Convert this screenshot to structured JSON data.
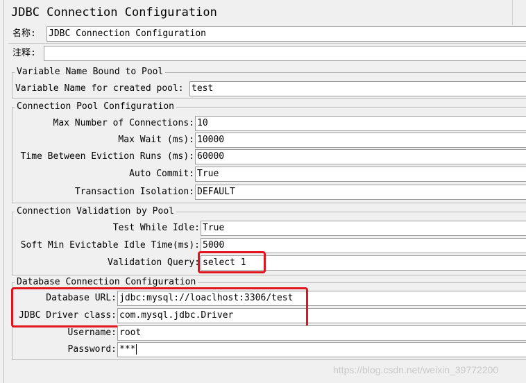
{
  "title": "JDBC Connection Configuration",
  "name_label": "名称:",
  "name_value": "JDBC Connection Configuration",
  "comment_label": "注释:",
  "comment_value": "",
  "variable_section": {
    "legend": "Variable Name Bound to Pool",
    "pool_var_label": "Variable Name for created pool:",
    "pool_var_value": "test"
  },
  "pool_section": {
    "legend": "Connection Pool Configuration",
    "max_conn_label": "Max Number of Connections:",
    "max_conn_value": "10",
    "max_wait_label": "Max Wait (ms):",
    "max_wait_value": "10000",
    "eviction_label": "Time Between Eviction Runs (ms):",
    "eviction_value": "60000",
    "auto_commit_label": "Auto Commit:",
    "auto_commit_value": "True",
    "isolation_label": "Transaction Isolation:",
    "isolation_value": "DEFAULT"
  },
  "validation_section": {
    "legend": "Connection Validation by Pool",
    "test_idle_label": "Test While Idle:",
    "test_idle_value": "True",
    "soft_min_label": "Soft Min Evictable Idle Time(ms):",
    "soft_min_value": "5000",
    "query_label": "Validation Query:",
    "query_value": "select 1"
  },
  "db_section": {
    "legend": "Database Connection Configuration",
    "url_label": "Database URL:",
    "url_value": "jdbc:mysql://loaclhost:3306/test",
    "driver_label": "JDBC Driver class:",
    "driver_value": "com.mysql.jdbc.Driver",
    "username_label": "Username:",
    "username_value": "root",
    "password_label": "Password:",
    "password_value": "***"
  },
  "watermark": "https://blog.csdn.net/weixin_39772200",
  "colors": {
    "highlight": "#e0141c",
    "background": "#f0f0f0",
    "field": "#ffffff"
  }
}
